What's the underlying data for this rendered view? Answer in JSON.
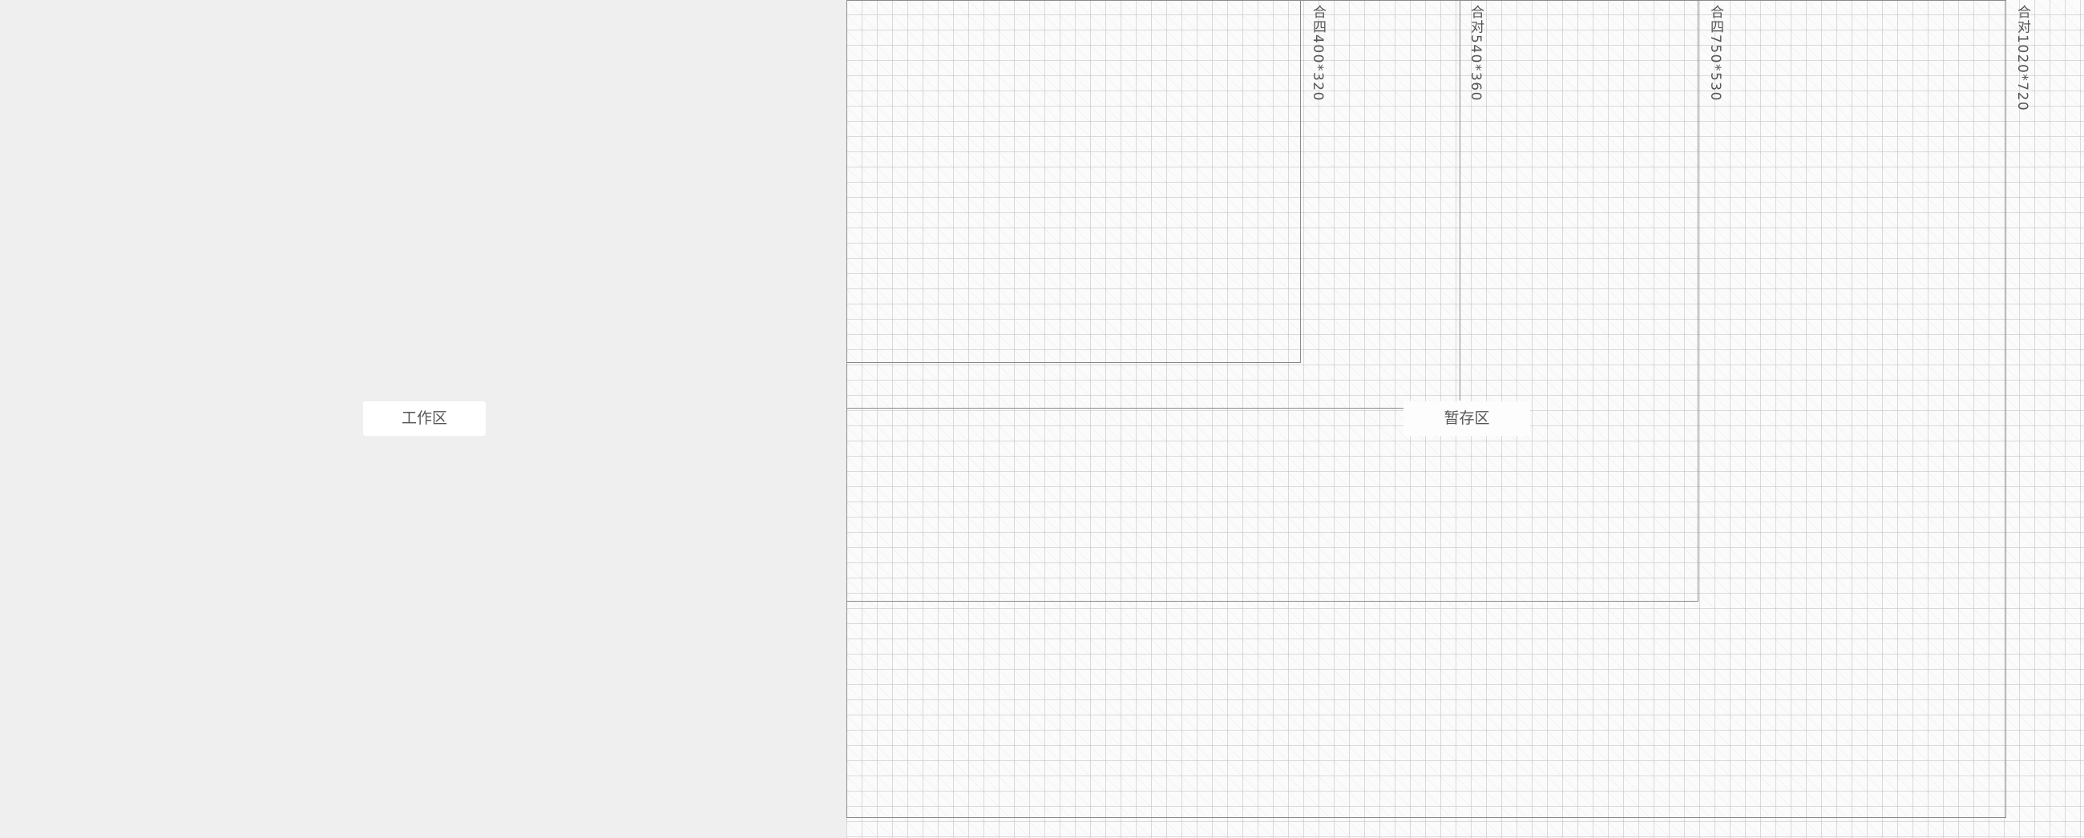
{
  "areas": {
    "workspace": "工作区",
    "stash": "暂存区"
  },
  "frames": [
    {
      "label": "合四400*320"
    },
    {
      "label": "合对540*360"
    },
    {
      "label": "合四750*530"
    },
    {
      "label": "合对1020*720"
    }
  ],
  "colors": {
    "workspace_bg": "#efefef",
    "stage_bg": "#fbfbfb",
    "grid_line": "#bebebe",
    "frame_line": "#8a8a8a"
  }
}
